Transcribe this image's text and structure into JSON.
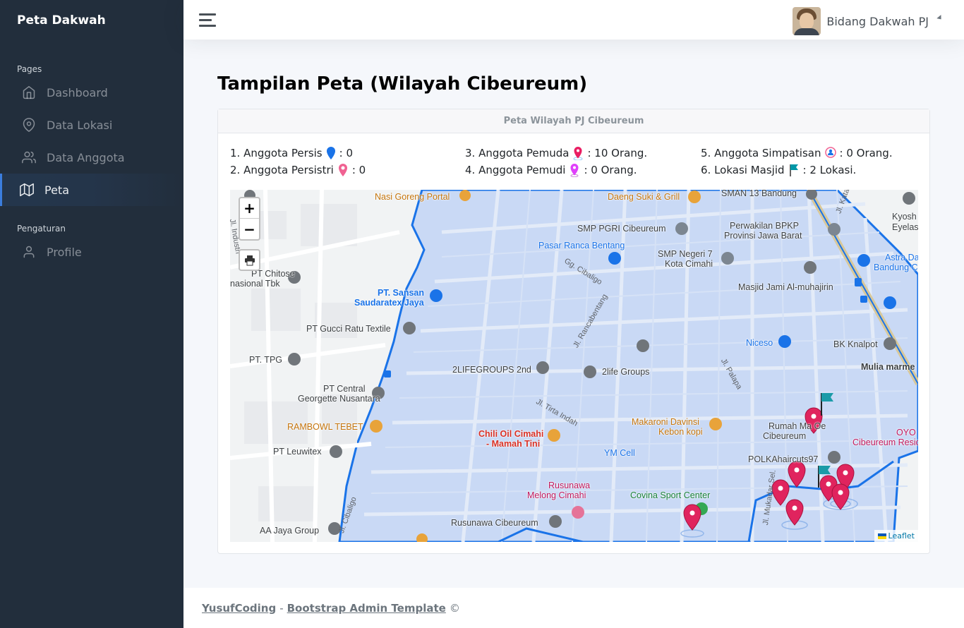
{
  "brand": "Peta Dakwah",
  "sidebar": {
    "header_pages": "Pages",
    "header_settings": "Pengaturan",
    "items": [
      {
        "label": "Dashboard",
        "icon": "home-icon"
      },
      {
        "label": "Data Lokasi",
        "icon": "map-pin-icon"
      },
      {
        "label": "Data Anggota",
        "icon": "users-icon"
      },
      {
        "label": "Peta",
        "icon": "map-icon",
        "active": true
      },
      {
        "label": "Profile",
        "icon": "user-icon"
      }
    ]
  },
  "topbar": {
    "user_name": "Bidang Dakwah PJ"
  },
  "page_title": "Tampilan Peta (Wilayah Cibeureum)",
  "card": {
    "header": "Peta Wilayah PJ Cibeureum",
    "legend": [
      {
        "prefix": "1. Anggota Persis",
        "suffix": ": 0",
        "icon": "blue-pin-icon",
        "color": "#1a73e8"
      },
      {
        "prefix": "2. Anggota Persistri",
        "suffix": ": 0",
        "icon": "pink-pin-icon",
        "color": "#f06292"
      },
      {
        "prefix": "3. Anggota Pemuda",
        "suffix": ": 10 Orang.",
        "icon": "red-pin-icon",
        "color": "#e91e63"
      },
      {
        "prefix": "4. Anggota Pemudi",
        "suffix": ": 0 Orang.",
        "icon": "magenta-pin-icon",
        "color": "#e040fb"
      },
      {
        "prefix": "5. Anggota Simpatisan",
        "suffix": ": 0 Orang.",
        "icon": "person-pin-icon",
        "color": "#f06292"
      },
      {
        "prefix": "6. Lokasi Masjid",
        "suffix": ": 2 Lokasi.",
        "icon": "flag-icon",
        "color": "#0097a7"
      }
    ]
  },
  "map": {
    "zoom_in": "+",
    "zoom_out": "−",
    "attribution": "Leaflet",
    "places": {
      "nasi_goreng": "Nasi Goreng Portal",
      "daeng_suki": "Daeng Suki & Grill",
      "sman13": "SMAN 13 Bandung",
      "kyosh": "Kyosh",
      "eyelas": "Eyelas",
      "smp_pgri": "SMP PGRI Cibeureum",
      "perwakilan1": "Perwakilan BPKP",
      "perwakilan2": "Provinsi Jawa Barat",
      "pasar": "Pasar Ranca Bentang",
      "smp7a": "SMP Negeri 7",
      "smp7b": "Kota Cimahi",
      "astra1": "Astra Daih",
      "astra2": "Bandung C",
      "chitose1": "PT Chitose",
      "chitose2": "nasional Tbk",
      "sansan1": "PT. Sansan",
      "sansan2": "Saudaratex Jaya",
      "masjid": "Masjid Jami Al-muhajirin",
      "gucci": "PT Gucci Ratu Textile",
      "niceso": "Niceso",
      "bk": "BK Knalpot",
      "tpg": "PT. TPG",
      "lifegroups": "2LIFEGROUPS 2nd",
      "2life": "2life Groups",
      "mulia": "Mulia marme",
      "central1": "PT Central",
      "central2": "Georgette Nusantara",
      "rambowl": "RAMBOWL TEBET",
      "chili1": "Chili Oil Cimahi",
      "chili2": "- Mamah Tini",
      "makaroni1": "Makaroni Davinsi",
      "makaroni2": "Kebon kopi",
      "rumah1": "Rumah Ma Oe",
      "rumah2": "Cibeureum",
      "oyo1": "OYO",
      "oyo2": "Cibeureum Resid",
      "leuwitex": "PT Leuwitex",
      "ymcell": "YM Cell",
      "polka": "POLKAhaircuts97",
      "rusunawa1": "Rusunawa",
      "rusunawa2": "Melong Cimahi",
      "covina": "Covina Sport Center",
      "aajaya": "AA Jaya Group",
      "rusunawa_cib": "Rusunawa Cibeureum"
    },
    "roads": {
      "gg_cibaligo": "Gg. Cibaligo",
      "rancabentang": "Jl. Rancabentang",
      "palapa": "Jl. Palapa",
      "tirta": "Jl. Tirta Indah",
      "cibaligo": "Jl. Cibaligo",
      "mukadar": "Jl. Mukadar Sel.",
      "industri": "Jl. Industri",
      "kata": "Jl. Kata"
    }
  },
  "footer": {
    "author": "YusufCoding",
    "separator": "-",
    "template": "Bootstrap Admin Template",
    "copyright": "©"
  }
}
